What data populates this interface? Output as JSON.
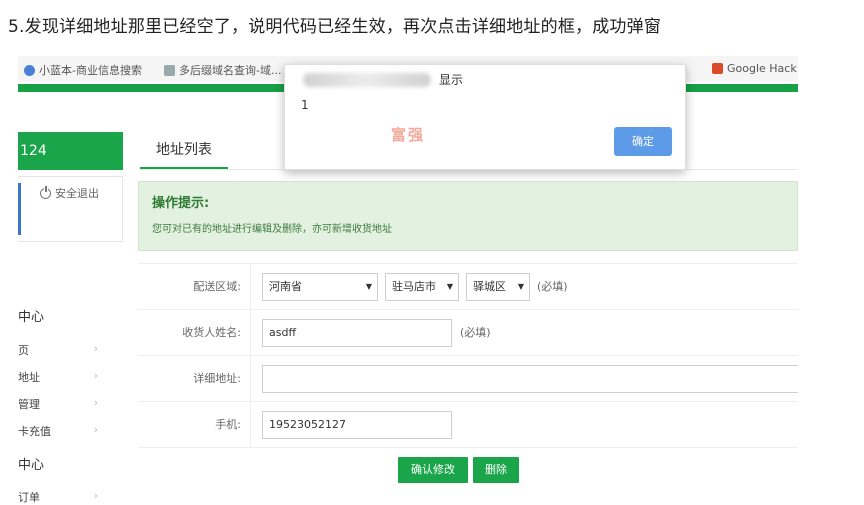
{
  "caption": "5.发现详细地址那里已经空了，说明代码已经生效，再次点击详细地址的框，成功弹窗",
  "bookmarks": [
    {
      "label": "小蓝本-商业信息搜索"
    },
    {
      "label": "多后缀域名查询-域..."
    },
    {
      "label": "Google Hack"
    }
  ],
  "sidebar": {
    "header": "124",
    "logout": "安全退出",
    "groups": [
      {
        "title": "中心",
        "items": [
          "页",
          "地址",
          "管理",
          "卡充值"
        ]
      },
      {
        "title": "中心",
        "items": [
          "订单"
        ]
      }
    ]
  },
  "tabs": {
    "active": "地址列表"
  },
  "tip": {
    "title": "操作提示:",
    "text": "您可对已有的地址进行编辑及删除，亦可新增收货地址"
  },
  "form": {
    "region_label": "配送区域:",
    "province": "河南省",
    "city": "驻马店市",
    "district": "驿城区",
    "region_required": "(必填)",
    "name_label": "收货人姓名:",
    "name_value": "asdff",
    "name_required": "(必填)",
    "address_label": "详细地址:",
    "address_value": "",
    "phone_label": "手机:",
    "phone_value": "19523052127",
    "save_label": "确认修改",
    "delete_label": "删除"
  },
  "dialog": {
    "title_suffix": "显示",
    "message": "1",
    "watermark": "富强",
    "ok_label": "确定"
  },
  "colors": {
    "brand_green": "#1aa54a",
    "dialog_button": "#5d9be9",
    "tip_background": "#e3f2e0"
  }
}
